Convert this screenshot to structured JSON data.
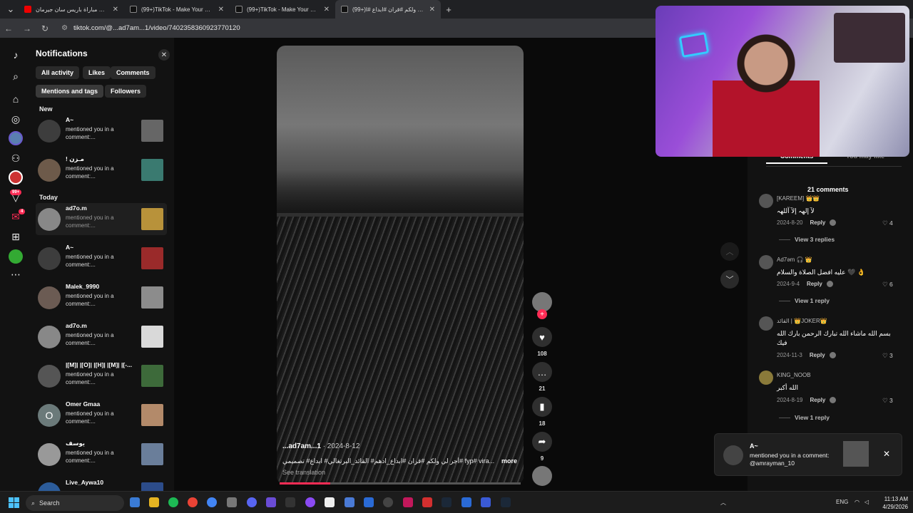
{
  "browser": {
    "tabs": [
      {
        "title": "ملخص مباراة باريس سان جيرمان",
        "icon": "youtube-icon"
      },
      {
        "title": "(99+)TikTok - Make Your Day",
        "icon": "tiktok-icon"
      },
      {
        "title": "(99+)TikTok - Make Your Day",
        "icon": "tiktok-icon"
      },
      {
        "title": "(99+)أجر لي ولكم #قران #ابداع #ا...",
        "icon": "tiktok-icon"
      }
    ],
    "url": "tiktok.com/@...ad7am...1/video/7402358360923770120"
  },
  "rail": {
    "badge_count": "99+",
    "badge_small": "4"
  },
  "notifications": {
    "title": "Notifications",
    "filters": [
      "All activity",
      "Likes",
      "Comments",
      "Mentions and tags",
      "Followers"
    ],
    "section_new": "New",
    "section_today": "Today",
    "items": [
      {
        "name": "A~",
        "text": "mentioned you in a comment:..."
      },
      {
        "name": "! مـزن",
        "text": "mentioned you in a comment:..."
      },
      {
        "name": "ad7o.m",
        "text": "mentioned you in a comment:..."
      },
      {
        "name": "A~",
        "text": "mentioned you in a comment:..."
      },
      {
        "name": "Malek_9990",
        "text": "mentioned you in a comment:..."
      },
      {
        "name": "ad7o.m",
        "text": "mentioned you in a comment:..."
      },
      {
        "name": "|[M]| |[O]| |[H]| |[M]| |[-...",
        "text": "mentioned you in a comment:..."
      },
      {
        "name": "Omer Gmaa",
        "text": "mentioned you in a comment:...",
        "avatar_letter": "O"
      },
      {
        "name": "يوسف",
        "text": "mentioned you in a comment:..."
      },
      {
        "name": "Live_Aywa10",
        "text": ""
      }
    ]
  },
  "video": {
    "author": "...ad7am...1",
    "date": " · 2024-8-12",
    "description": "أجر لي ولكم #قران #ابداع_ادهم# القائد_البرتغالي# ابداع# تصميمي# fyp# vira...",
    "more": "more",
    "see_translation": "See translation",
    "progress": 0.21,
    "likes": "108",
    "comments": "21",
    "saves": "18",
    "shares": "9"
  },
  "comments": {
    "tab_comments": "Comments",
    "tab_you_may_like": "You may like",
    "count_label": "21 comments",
    "items": [
      {
        "user": "[KAREEM] 👑👑",
        "body": "لآ إلهہ إلآ آللهہ",
        "date": "2024-8-20",
        "reply": "Reply",
        "likes": "4",
        "view_replies": "View 3 replies"
      },
      {
        "user": "Ad7əm 🎧 👑",
        "body": "عليه افضل الصلاة والسلام 🖤 👌",
        "date": "2024-9-4",
        "reply": "Reply",
        "likes": "6",
        "view_replies": "View 1 reply"
      },
      {
        "user": "القائد | 👑JOKER👑",
        "body": "بسم الله ماشاء الله تبارك الرحمن بارك الله فيك",
        "date": "2024-11-3",
        "reply": "Reply",
        "likes": "3",
        "view_replies": ""
      },
      {
        "user": "KING_NOOB",
        "body": "الله أكبر",
        "date": "2024-8-19",
        "reply": "Reply",
        "likes": "3",
        "view_replies": "View 1 reply"
      }
    ]
  },
  "toast": {
    "name": "A~",
    "text": "mentioned you in a comment: @amrayman_10"
  },
  "taskbar": {
    "search": "Search",
    "lang": "ENG",
    "time": "11:13 AM",
    "date": "4/29/2026"
  },
  "colors": {
    "accent": "#fe2c55",
    "windows_blue": "#4cc2ff"
  }
}
